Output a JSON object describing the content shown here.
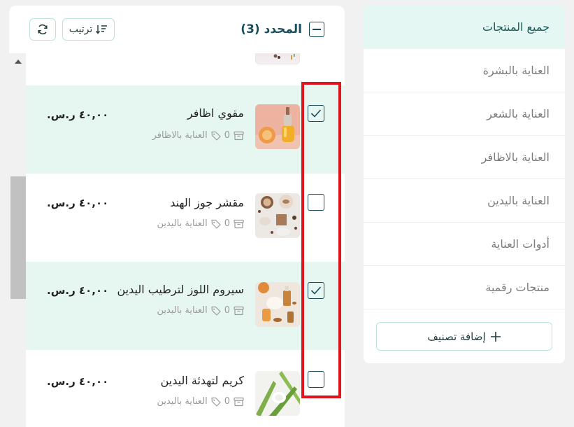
{
  "categories": {
    "items": [
      {
        "label": "جميع المنتجات",
        "active": true
      },
      {
        "label": "العناية بالبشرة",
        "active": false
      },
      {
        "label": "العناية بالشعر",
        "active": false
      },
      {
        "label": "العناية بالاظافر",
        "active": false
      },
      {
        "label": "العناية باليدين",
        "active": false
      },
      {
        "label": "أدوات العناية",
        "active": false
      },
      {
        "label": "منتجات رقمية",
        "active": false
      }
    ],
    "add_label": "إضافة تصنيف"
  },
  "toolbar": {
    "selected_label": "المحدد (3)",
    "sort_label": "ترتيب"
  },
  "products": [
    {
      "name": "مقوي اظافر",
      "category": "العناية بالاظافر",
      "stock": "0",
      "price": "٤٠,٠٠ ر.س.",
      "checked": true,
      "thumb": "serum-orange"
    },
    {
      "name": "مقشر جوز الهند",
      "category": "العناية باليدين",
      "stock": "0",
      "price": "٤٠,٠٠ ر.س.",
      "checked": false,
      "thumb": "coconut-scrub"
    },
    {
      "name": "سيروم اللوز لترطيب اليدين",
      "category": "العناية باليدين",
      "stock": "0",
      "price": "٤٠,٠٠ ر.س.",
      "checked": true,
      "thumb": "almond-serum"
    },
    {
      "name": "كريم لتهدئة اليدين",
      "category": "العناية باليدين",
      "stock": "0",
      "price": "٤٠,٠٠ ر.س.",
      "checked": false,
      "thumb": "aloe-cream"
    }
  ],
  "colors": {
    "accent": "#1a4d5c",
    "selected_row": "#e6f7f2",
    "highlight": "#e0141c"
  }
}
